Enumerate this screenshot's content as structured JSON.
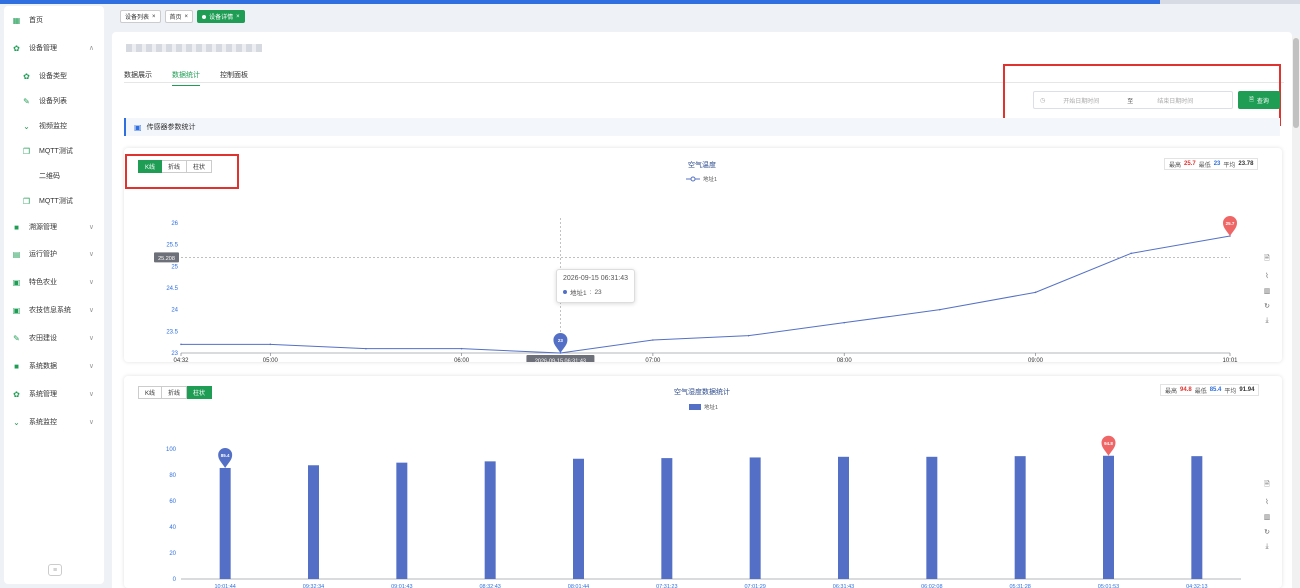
{
  "sidebar": {
    "items": [
      {
        "label": "首页",
        "icon": "dashboard-icon",
        "level": 0,
        "chevron": ""
      },
      {
        "label": "设备管理",
        "icon": "gear-icon",
        "level": 0,
        "chevron": "∧"
      },
      {
        "label": "设备类型",
        "icon": "gear-icon",
        "level": 1,
        "chevron": ""
      },
      {
        "label": "设备列表",
        "icon": "pencil-icon",
        "level": 1,
        "chevron": ""
      },
      {
        "label": "视频监控",
        "icon": "chevron-down-icon",
        "level": 1,
        "chevron": ""
      },
      {
        "label": "MQTT测试",
        "icon": "copy-icon",
        "level": 1,
        "chevron": ""
      },
      {
        "label": "二维码",
        "icon": "",
        "level": 2,
        "chevron": ""
      },
      {
        "label": "MQTT测试",
        "icon": "copy-icon",
        "level": 1,
        "chevron": ""
      },
      {
        "label": "溯源管理",
        "icon": "folder-icon",
        "level": 0,
        "chevron": "∨"
      },
      {
        "label": "运行管护",
        "icon": "calendar-icon",
        "level": 0,
        "chevron": "∨"
      },
      {
        "label": "特色农业",
        "icon": "document-icon",
        "level": 0,
        "chevron": "∨"
      },
      {
        "label": "农技信息系统",
        "icon": "document-icon",
        "level": 0,
        "chevron": "∨"
      },
      {
        "label": "农田建设",
        "icon": "pencil-icon",
        "level": 0,
        "chevron": "∨"
      },
      {
        "label": "系统数据",
        "icon": "folder-icon",
        "level": 0,
        "chevron": "∨"
      },
      {
        "label": "系统管理",
        "icon": "gear-icon",
        "level": 0,
        "chevron": "∨"
      },
      {
        "label": "系统监控",
        "icon": "chevron-down-icon",
        "level": 0,
        "chevron": "∨"
      }
    ]
  },
  "tabbar": {
    "tags": [
      {
        "label": "设备列表",
        "active": false
      },
      {
        "label": "首页",
        "active": false
      },
      {
        "label": "设备详情",
        "active": true
      }
    ]
  },
  "tabs": [
    "数据展示",
    "数据统计",
    "控制面板"
  ],
  "active_tab": "数据统计",
  "date_range": {
    "start_placeholder": "开始日期时间",
    "separator": "至",
    "end_placeholder": "结束日期时间"
  },
  "query_button": "查询",
  "section_title": "传感器参数统计",
  "chart_types": [
    "K线",
    "折线",
    "柱状"
  ],
  "colors": {
    "accent": "#1f9d55",
    "series": "#5470c6",
    "max": "#ee6666",
    "highlight": "#e0332f"
  },
  "chart1": {
    "active_type": "K线",
    "stats": {
      "max_label": "最高",
      "max": "25.7",
      "min_label": "最低",
      "min": "23",
      "avg_label": "平均",
      "avg": "23.78"
    },
    "tooltip": {
      "time": "2026-09-15 06:31:43",
      "series": "地址1",
      "value": "23"
    },
    "crosshair": {
      "y_label": "25.208",
      "x_label": "2026-09-15 06:31:43"
    },
    "markers": {
      "min": "23",
      "max": "25.7"
    }
  },
  "chart2": {
    "active_type": "柱状",
    "stats": {
      "max_label": "最高",
      "max": "94.8",
      "min_label": "最低",
      "min": "85.4",
      "avg_label": "平均",
      "avg": "91.94"
    },
    "markers": {
      "min": "85.4",
      "max": "94.8"
    }
  },
  "chart_data": [
    {
      "type": "line",
      "title": "空气温度",
      "series": [
        {
          "name": "地址1",
          "x": [
            "04:32",
            "05:00",
            "05:30",
            "06:00",
            "06:31",
            "07:00",
            "07:30",
            "08:00",
            "08:30",
            "09:00",
            "09:30",
            "10:01"
          ],
          "values": [
            23.2,
            23.2,
            23.1,
            23.1,
            23.0,
            23.3,
            23.4,
            23.7,
            24.0,
            24.4,
            25.3,
            25.7
          ]
        }
      ],
      "ylim": [
        23,
        26
      ],
      "yticks": [
        "23",
        "23.5",
        "24",
        "24.5",
        "25",
        "25.5",
        "26"
      ],
      "xticks": [
        "04:32",
        "05:00",
        "06:00",
        "07:00",
        "08:00",
        "09:00",
        "10:01"
      ],
      "grid": false,
      "legend": "top-center"
    },
    {
      "type": "bar",
      "title": "空气湿度数据统计",
      "categories": [
        "10:01:44",
        "09:32:34",
        "09:01:43",
        "08:32:43",
        "08:01:44",
        "07:31:23",
        "07:01:29",
        "06:31:43",
        "06:02:08",
        "05:31:28",
        "05:01:53",
        "04:32:13"
      ],
      "series": [
        {
          "name": "地址1",
          "values": [
            85.4,
            87.5,
            89.5,
            90.5,
            92.5,
            93.0,
            93.5,
            94.0,
            94.0,
            94.5,
            94.8,
            94.5
          ]
        }
      ],
      "ylim": [
        0,
        100
      ],
      "yticks": [
        "0",
        "20",
        "40",
        "60",
        "80",
        "100"
      ],
      "grid": false,
      "legend": "top-center"
    }
  ]
}
